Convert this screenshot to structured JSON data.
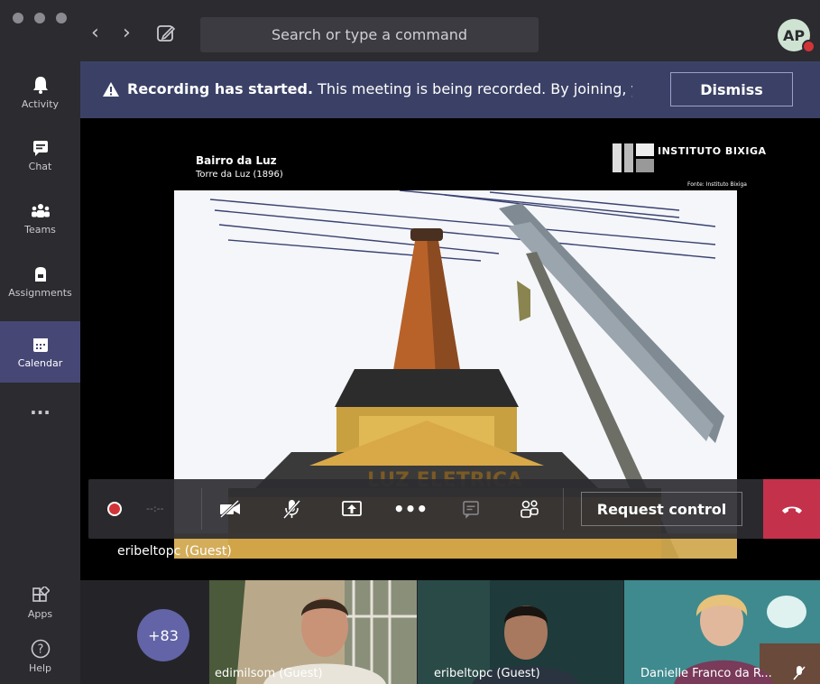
{
  "search": {
    "placeholder": "Search or type a command"
  },
  "avatar": {
    "initials": "AP"
  },
  "rail": {
    "items": [
      {
        "label": "Activity"
      },
      {
        "label": "Chat"
      },
      {
        "label": "Teams"
      },
      {
        "label": "Assignments"
      },
      {
        "label": "Calendar"
      },
      {
        "label": "..."
      },
      {
        "label": "Apps"
      },
      {
        "label": "Help"
      }
    ]
  },
  "banner": {
    "bold": "Recording has started.",
    "text": " This meeting is being recorded. By joining, y...",
    "dismiss_label": "Dismiss"
  },
  "slide": {
    "title": "Bairro da Luz",
    "subtitle": "Torre da Luz (1896)",
    "logo": "INSTITUTO BIXIGA",
    "credit": "Fonte: Instituto Bixiga",
    "sign_text": "LUZ ELETRICA"
  },
  "controls": {
    "timer": "--:--",
    "request_control_label": "Request control"
  },
  "presenter": {
    "name": "eribeltopc (Guest)"
  },
  "participants": {
    "more_count": "+83",
    "tiles": [
      {
        "name": "edimilsom (Guest)"
      },
      {
        "name": "eribeltopc (Guest)"
      },
      {
        "name": "Danielle Franco da R..."
      }
    ]
  },
  "colors": {
    "accent": "#6264a7",
    "banner": "#3b4166",
    "hangup": "#c4314b",
    "rail": "#2b2b30"
  }
}
